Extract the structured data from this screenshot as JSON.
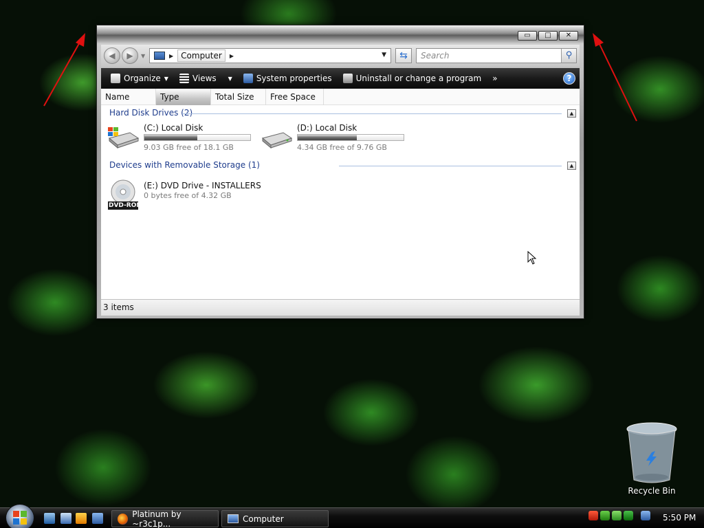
{
  "window": {
    "caption_minimize": "▭",
    "caption_maximize": "□",
    "caption_close": "✕"
  },
  "address_bar": {
    "crumb": "Computer",
    "search_placeholder": "Search"
  },
  "toolbar": {
    "organize": "Organize",
    "views": "Views",
    "system_properties": "System properties",
    "uninstall": "Uninstall or change a program",
    "more": "»",
    "help": "?"
  },
  "columns": [
    "Name",
    "Type",
    "Total Size",
    "Free Space"
  ],
  "groups": {
    "hard_disks": {
      "label": "Hard Disk Drives (2)",
      "drives": [
        {
          "name": "(C:) Local Disk",
          "free": "9.03 GB free of 18.1 GB",
          "used_fraction": 0.5
        },
        {
          "name": "(D:) Local Disk",
          "free": "4.34 GB free of 9.76 GB",
          "used_fraction": 0.56
        }
      ]
    },
    "removable": {
      "label": "Devices with Removable Storage (1)",
      "drives": [
        {
          "name": "(E:) DVD Drive - INSTALLERS",
          "free": "0 bytes free of 4.32 GB",
          "icon_label": "DVD-ROM"
        }
      ]
    }
  },
  "status": {
    "items": "3 items"
  },
  "desktop": {
    "recycle_bin": "Recycle Bin"
  },
  "taskbar": {
    "tasks": [
      "Platinum by ~r3c1p...",
      "Computer"
    ],
    "clock": "5:50 PM"
  },
  "colors": {
    "arrow": "#e01010",
    "accent": "#1e3c8c"
  }
}
